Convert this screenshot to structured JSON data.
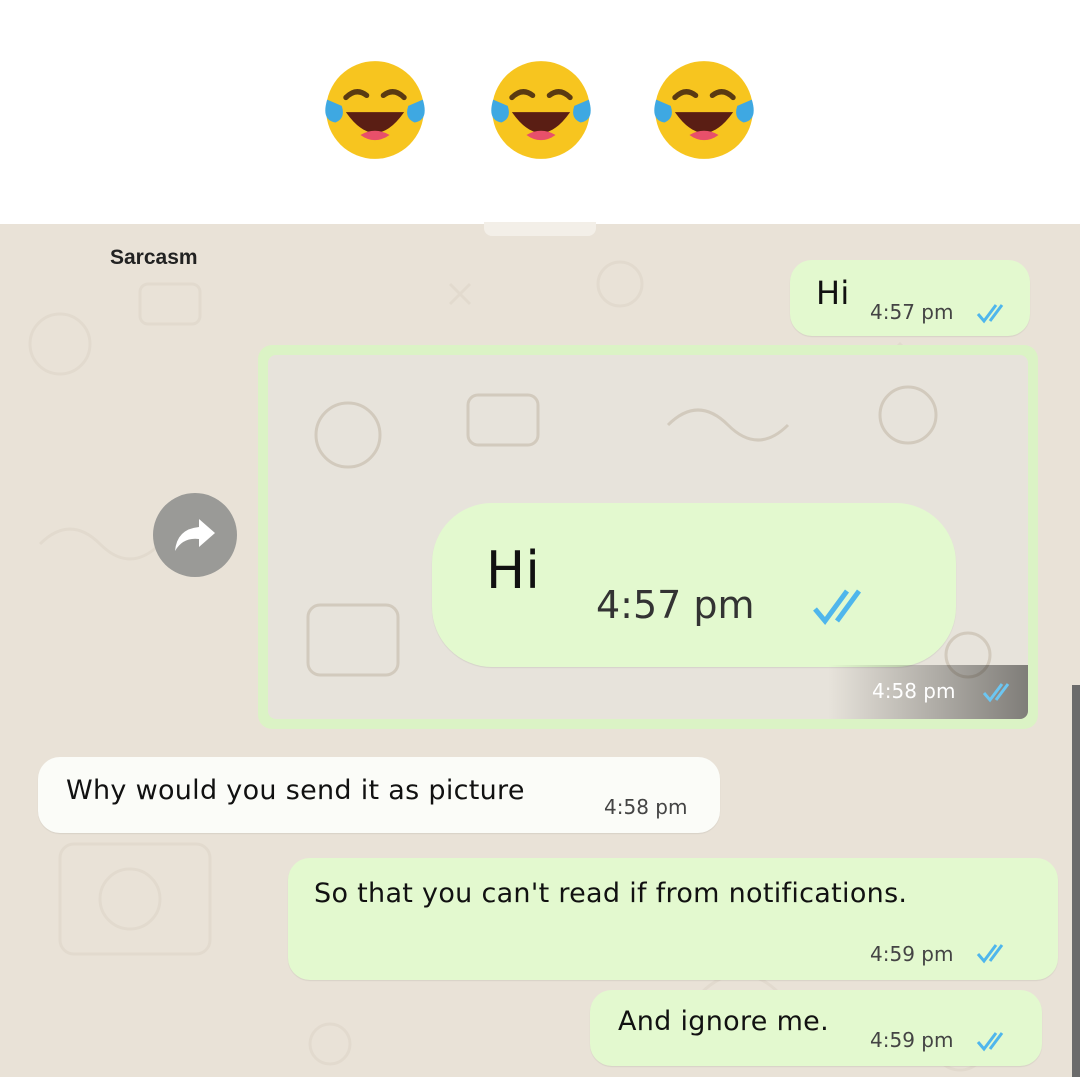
{
  "header": {
    "emojis": [
      "face-with-tears-of-joy-icon",
      "face-with-tears-of-joy-icon",
      "face-with-tears-of-joy-icon"
    ]
  },
  "watermark": "Sarcasm",
  "colors": {
    "chat_background": "#e9e2d7",
    "outgoing_bubble": "#e3f9cf",
    "incoming_bubble": "#fbfcf8",
    "read_ticks": "#4fb6ec"
  },
  "messages": [
    {
      "direction": "out",
      "text": "Hi",
      "time": "4:57 pm",
      "status": "read"
    },
    {
      "direction": "out",
      "type": "image",
      "image": {
        "text": "Hi",
        "time": "4:57 pm",
        "status": "read"
      },
      "time": "4:58 pm",
      "status": "read"
    },
    {
      "direction": "in",
      "text": "Why would you send it as picture",
      "time": "4:58 pm"
    },
    {
      "direction": "out",
      "text": "So that you can't read if from notifications.",
      "time": "4:59 pm",
      "status": "read"
    },
    {
      "direction": "out",
      "text": "And ignore me.",
      "time": "4:59 pm",
      "status": "read"
    }
  ]
}
